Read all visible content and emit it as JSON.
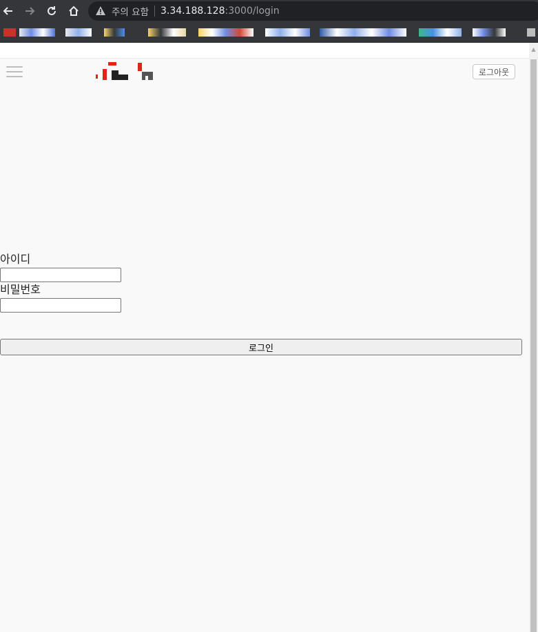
{
  "browser": {
    "back_icon": "arrow-left-icon",
    "forward_icon": "arrow-right-icon",
    "reload_icon": "reload-icon",
    "home_icon": "home-icon",
    "security_label": "주의 요함",
    "url_host": "3.34.188.128",
    "url_rest": ":3000/login"
  },
  "header": {
    "menu_icon": "hamburger-menu-icon",
    "logout_label": "로그아웃"
  },
  "login_form": {
    "id_label": "아이디",
    "id_value": "",
    "password_label": "비밀번호",
    "password_value": "",
    "submit_label": "로그인"
  },
  "colors": {
    "toolbar_bg": "#35363a",
    "omnibox_bg": "#202124",
    "page_bg": "#f9f9f9",
    "logo_red": "#e2231a",
    "logo_dark": "#222222"
  }
}
